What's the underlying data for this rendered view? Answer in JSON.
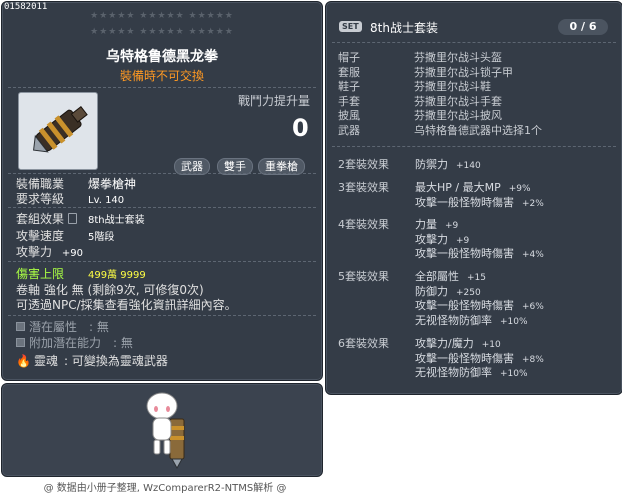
{
  "item": {
    "id": "01582011",
    "stars_row1": "★★★★★ ★★★★★ ★★★★★",
    "stars_row2": "★★★★★ ★★★★★ ★★★★★",
    "name": "乌特格鲁德黑龙拳",
    "trade_note": "裝備時不可交換",
    "power_label": "戰鬥力提升量",
    "power_value": "0",
    "tags": [
      "武器",
      "雙手",
      "重拳槍"
    ],
    "job_label": "裝備職業",
    "job_value": "爆拳槍神",
    "level_label": "要求等級",
    "level_value": "Lv. 140",
    "set_label": "套組效果",
    "set_value": "8th战士套装",
    "speed_label": "攻擊速度",
    "speed_value": "5階段",
    "attack_label": "攻擊力",
    "attack_value": "+90",
    "damage_cap_label": "傷害上限",
    "damage_cap_value": "499萬 9999",
    "scroll_line": "卷軸 強化 無 (剩餘9次, 可修復0次)",
    "npc_line": "可透過NPC/採集查看強化資訊詳細內容。",
    "potential_label": "潛在屬性",
    "potential_value": ": 無",
    "add_potential_label": "附加潛在能力",
    "add_potential_value": ": 無",
    "soul_label": "靈魂",
    "soul_value": ": 可變換為靈魂武器"
  },
  "set": {
    "badge": "SET",
    "title": "8th战士套装",
    "count": "0 / 6",
    "pieces": [
      {
        "slot": "帽子",
        "name": "芬撒里尔战斗头盔"
      },
      {
        "slot": "套服",
        "name": "芬撒里尔战斗锁子甲"
      },
      {
        "slot": "鞋子",
        "name": "芬撒里尔战斗鞋"
      },
      {
        "slot": "手套",
        "name": "芬撒里尔战斗手套"
      },
      {
        "slot": "披風",
        "name": "芬撒里尔战斗披风"
      },
      {
        "slot": "武器",
        "name": "乌特格鲁德武器中选择1个"
      }
    ],
    "bonuses": [
      {
        "label": "2套裝效果",
        "lines": [
          {
            "text": "防禦力",
            "num": "+140"
          }
        ]
      },
      {
        "label": "3套裝效果",
        "lines": [
          {
            "text": "最大HP / 最大MP",
            "num": "+9%"
          },
          {
            "text": "攻擊一般怪物時傷害",
            "num": "+2%"
          }
        ]
      },
      {
        "label": "4套裝效果",
        "lines": [
          {
            "text": "力量",
            "num": "+9"
          },
          {
            "text": "攻擊力",
            "num": "+9"
          },
          {
            "text": "攻擊一般怪物時傷害",
            "num": "+4%"
          }
        ]
      },
      {
        "label": "5套裝效果",
        "lines": [
          {
            "text": "全部屬性",
            "num": "+15"
          },
          {
            "text": "防御力",
            "num": "+250"
          },
          {
            "text": "攻擊一般怪物時傷害",
            "num": "+6%"
          },
          {
            "text": "无视怪物防御率",
            "num": "+10%"
          }
        ]
      },
      {
        "label": "6套裝效果",
        "lines": [
          {
            "text": "攻擊力/魔力",
            "num": "+10"
          },
          {
            "text": "攻擊一般怪物時傷害",
            "num": "+8%"
          },
          {
            "text": "无视怪物防御率",
            "num": "+10%"
          }
        ]
      }
    ]
  },
  "footer": "@ 数据由小册子整理, WzComparerR2-NTMS解析 @"
}
